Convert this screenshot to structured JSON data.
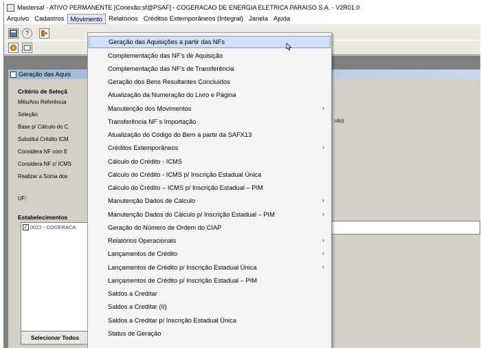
{
  "window": {
    "title": "Mastersaf - ATIVO PERMANENTE [Conexão:sf@PSAF] - COGERACAO DE ENERGIA ELETRICA PARAISO S.A. - V2R01.0"
  },
  "menubar": [
    {
      "label": "Arquivo"
    },
    {
      "label": "Cadastros"
    },
    {
      "label": "Movimento"
    },
    {
      "label": "Relatórios"
    },
    {
      "label": "Créditos Extemporâneos (Integral)"
    },
    {
      "label": "Janela"
    },
    {
      "label": "Ajuda"
    }
  ],
  "child": {
    "title": "Geração das Aquis",
    "criteria_heading": "Critério de Seleçã",
    "labels": [
      "Mês/Ano Referência",
      "Seleção:",
      "Base p/ Cálculo do C",
      "Substitui Crédito ICM",
      "Considera NF com E",
      "Considera NF c/ ICMS",
      "Realizar a Soma dos"
    ],
    "uf_label": "UF:",
    "right_fragment": "uto)",
    "establishments_heading": "Estabelecimentos",
    "establishment_item": "0022 - COGERACA",
    "select_all_button": "Selecionar Todos"
  },
  "dropdown": [
    {
      "label": "Geração das Aquisições a partir das NFs",
      "submenu": false,
      "highlighted": true
    },
    {
      "label": "Complementação das NF's de Aquisição",
      "submenu": false
    },
    {
      "label": "Complementação das NF's de Transferência",
      "submenu": false
    },
    {
      "label": "Geração dos Bens Resultantes Concluídos",
      "submenu": false
    },
    {
      "label": "Atualização da Numeração do Livro e Página",
      "submenu": false
    },
    {
      "label": "Manutenção dos Movimentos",
      "submenu": true
    },
    {
      "label": "Transferência NF´s Importação",
      "submenu": false
    },
    {
      "label": "Atualização do Código do Bem a partir da SAFX13",
      "submenu": false
    },
    {
      "label": "Créditos Extemporâneos",
      "submenu": true
    },
    {
      "label": "Cálculo do Crédito - ICMS",
      "submenu": false
    },
    {
      "label": "Cálculo do Crédito - ICMS p/ Inscrição Estadual Única",
      "submenu": false
    },
    {
      "label": "Cálculo do Crédito – ICMS p/ Inscrição Estadual – PIM",
      "submenu": false
    },
    {
      "label": "Manutenção Dados de Cálculo",
      "submenu": true
    },
    {
      "label": "Manutenção Dados do Cálculo p/ Inscrição Estadual – PIM",
      "submenu": true
    },
    {
      "label": "Geração do Número de Ordem do CIAP",
      "submenu": false
    },
    {
      "label": "Relatórios Operacionais",
      "submenu": true
    },
    {
      "label": "Lançamentos de Crédito",
      "submenu": true
    },
    {
      "label": "Lançamentos de Crédito p/ Inscrição Estadual Única",
      "submenu": true
    },
    {
      "label": "Lançamentos de Crédito p/ Inscrição Estadual – PIM",
      "submenu": false
    },
    {
      "label": "Saldos a Creditar",
      "submenu": false
    },
    {
      "label": "Saldos a Creditar (II)",
      "submenu": false
    },
    {
      "label": "Saldos a Creditar p/ Inscrição Estadual Única",
      "submenu": false
    },
    {
      "label": "Status de Geração",
      "submenu": false
    }
  ]
}
